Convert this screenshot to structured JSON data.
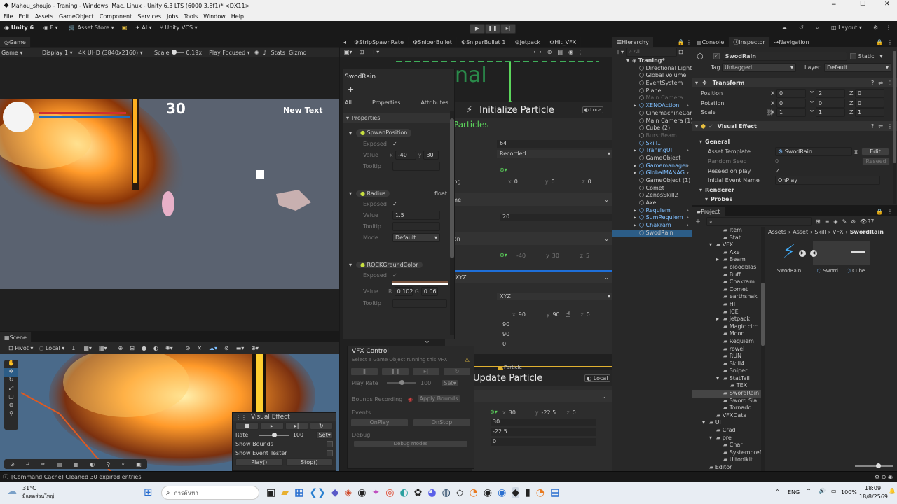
{
  "window": {
    "title": "Mahou_shoujo - Traning - Windows, Mac, Linux - Unity 6.3 LTS (6000.3.8f1)* <DX11>",
    "min": "−",
    "max": "☐",
    "close": "✕"
  },
  "menubar": [
    "File",
    "Edit",
    "Assets",
    "GameObject",
    "Component",
    "Services",
    "Jobs",
    "Tools",
    "Window",
    "Help"
  ],
  "toolbar": {
    "unity": "Unity 6",
    "account": "F",
    "asset_store": "Asset Store",
    "ai": "AI",
    "vcs": "Unity VCS",
    "layout": "Layout"
  },
  "game": {
    "tab": "Game",
    "mode": "Game",
    "display": "Display 1",
    "resolution": "4K UHD (3840x2160)",
    "scale_label": "Scale",
    "scale_value": "0.19x",
    "play_focused": "Play Focused",
    "stats": "Stats",
    "gizmos": "Gizmo",
    "score": "30",
    "new_text": "New Text"
  },
  "scene": {
    "tab": "Scene",
    "pivot": "Pivot",
    "local": "Local",
    "snap": "1",
    "overlay_title": "Visual Effect",
    "rate_label": "Rate",
    "rate_value": "100",
    "rate_set": "Set",
    "show_bounds": "Show Bounds",
    "show_event_tester": "Show Event Tester",
    "play": "Play()",
    "stop": "Stop()"
  },
  "vfx_tabs": [
    "StripSpawnRate",
    "SniperBullet",
    "SniperBullet 1",
    "Jetpack",
    "Hit_VFX"
  ],
  "blackboard": {
    "title": "SwodRain",
    "add": "+",
    "tab_all": "All",
    "tab_properties": "Properties",
    "tab_attributes": "Attributes",
    "section": "Properties",
    "props": [
      {
        "name": "SpwanPosition",
        "type": "",
        "exposed_label": "Exposed",
        "value_label": "Value",
        "x_label": "x",
        "x": "-40",
        "y_label": "y",
        "y": "30",
        "tooltip_label": "Tooltip"
      },
      {
        "name": "Radius",
        "type": "float",
        "exposed_label": "Exposed",
        "value_label": "Value",
        "value": "1.5",
        "tooltip_label": "Tooltip",
        "mode_label": "Mode",
        "mode": "Default"
      },
      {
        "name": "ROCKGroundColor",
        "type": "",
        "exposed_label": "Exposed",
        "value_label": "Value",
        "r_label": "R",
        "r": "0.102",
        "g_label": "G",
        "g": "0.06",
        "tooltip_label": "Tooltip"
      }
    ]
  },
  "graph": {
    "title_fragment": "nal",
    "init_title": "Initialize Particle",
    "local": "Loca",
    "particles": "Particles",
    "capacity": "64",
    "bounds_mode": "Recorded",
    "padding_label": "dding",
    "pad_x": "0",
    "pad_y": "0",
    "pad_z": "0",
    "lifetime_label": "etime",
    "lifetime": "20",
    "position_label": "sition",
    "pos_x": "-40",
    "pos_y": "30",
    "pos_z": "5",
    "angle_label": "gle.XYZ",
    "angle_mode": "XYZ",
    "ang_x": "90",
    "ang_y": "90",
    "ang_z": "0",
    "v1": "90",
    "v2": "90",
    "v3": "0",
    "y_label": "Y",
    "update_context": "Particle",
    "update_title": "Update Particle",
    "update_local": "Local",
    "upd_x": "30",
    "upd_y": "-22.5",
    "upd_z": "0",
    "u1": "30",
    "u2": "-22.5",
    "u3": "0"
  },
  "vfx_control": {
    "title": "VFX Control",
    "subtitle": "Select a Game Object running this VFX",
    "play_rate_label": "Play Rate",
    "play_rate": "100",
    "set": "Set",
    "bounds_label": "Bounds Recording",
    "apply_bounds": "Apply Bounds",
    "events_label": "Events",
    "onplay": "OnPlay",
    "onstop": "OnStop",
    "debug_label": "Debug",
    "debug_modes": "Debug modes"
  },
  "hierarchy": {
    "tab": "Hierarchy",
    "search": "All",
    "items": [
      {
        "label": "Traning*",
        "depth": 0,
        "arrow": "▾",
        "kind": "scene"
      },
      {
        "label": "Directional Light",
        "depth": 1,
        "arrow": "",
        "kind": "go"
      },
      {
        "label": "Global Volume",
        "depth": 1,
        "arrow": "",
        "kind": "go"
      },
      {
        "label": "EventSystem",
        "depth": 1,
        "arrow": "",
        "kind": "go"
      },
      {
        "label": "Plane",
        "depth": 1,
        "arrow": "",
        "kind": "go"
      },
      {
        "label": "Main Camera",
        "depth": 1,
        "arrow": "",
        "kind": "dim"
      },
      {
        "label": "XENOAction",
        "depth": 1,
        "arrow": "▸",
        "kind": "prefab"
      },
      {
        "label": "CinemachineCam",
        "depth": 1,
        "arrow": "",
        "kind": "go"
      },
      {
        "label": "Main Camera (1)",
        "depth": 1,
        "arrow": "",
        "kind": "go"
      },
      {
        "label": "Cube (2)",
        "depth": 1,
        "arrow": "",
        "kind": "go"
      },
      {
        "label": "BurstBeam",
        "depth": 1,
        "arrow": "",
        "kind": "dim"
      },
      {
        "label": "Skill1",
        "depth": 1,
        "arrow": "",
        "kind": "prefab"
      },
      {
        "label": "TraningUI",
        "depth": 1,
        "arrow": "▸",
        "kind": "prefab"
      },
      {
        "label": "GameObject",
        "depth": 1,
        "arrow": "",
        "kind": "go"
      },
      {
        "label": "Gamemanager",
        "depth": 1,
        "arrow": "▸",
        "kind": "prefab"
      },
      {
        "label": "GlobalMANAG",
        "depth": 1,
        "arrow": "▸",
        "kind": "prefab"
      },
      {
        "label": "GameObject (1)",
        "depth": 1,
        "arrow": "",
        "kind": "go"
      },
      {
        "label": "Comet",
        "depth": 1,
        "arrow": "",
        "kind": "go"
      },
      {
        "label": "ZenosSkill2",
        "depth": 1,
        "arrow": "",
        "kind": "go"
      },
      {
        "label": "Axe",
        "depth": 1,
        "arrow": "",
        "kind": "go"
      },
      {
        "label": "Requiem",
        "depth": 1,
        "arrow": "▸",
        "kind": "prefab"
      },
      {
        "label": "SumRequiem",
        "depth": 1,
        "arrow": "▸",
        "kind": "prefab"
      },
      {
        "label": "Chakram",
        "depth": 1,
        "arrow": "▸",
        "kind": "prefab"
      },
      {
        "label": "SwodRain",
        "depth": 1,
        "arrow": "",
        "kind": "selected"
      }
    ]
  },
  "inspector": {
    "tab_console": "Console",
    "tab_inspector": "Inspector",
    "tab_navigation": "Navigation",
    "object_name": "SwodRain",
    "static": "Static",
    "tag_label": "Tag",
    "tag": "Untagged",
    "layer_label": "Layer",
    "layer": "Default",
    "transform": {
      "title": "Transform",
      "rows": [
        {
          "label": "Position",
          "x": "0",
          "y": "2",
          "z": "0"
        },
        {
          "label": "Rotation",
          "x": "0",
          "y": "0",
          "z": "0"
        },
        {
          "label": "Scale",
          "x": "1",
          "y": "1",
          "z": "1"
        }
      ]
    },
    "vfx": {
      "title": "Visual Effect",
      "general": "General",
      "asset_template_label": "Asset Template",
      "asset_template": "SwodRain",
      "edit": "Edit",
      "random_seed_label": "Random Seed",
      "random_seed": "0",
      "reseed": "Reseed",
      "reseed_on_play": "Reseed on play",
      "initial_event_label": "Initial Event Name",
      "initial_event": "OnPlay",
      "renderer": "Renderer",
      "probes": "Probes"
    }
  },
  "project": {
    "tab": "Project",
    "count": "37",
    "breadcrumb": [
      "Assets",
      "Asset",
      "Skill",
      "VFX",
      "SwordRain"
    ],
    "tree": [
      {
        "label": "Item",
        "depth": 3,
        "arrow": ""
      },
      {
        "label": "Stat",
        "depth": 3,
        "arrow": ""
      },
      {
        "label": "VFX",
        "depth": 2,
        "arrow": "▾"
      },
      {
        "label": "Axe",
        "depth": 3,
        "arrow": ""
      },
      {
        "label": "Beam",
        "depth": 3,
        "arrow": "▸"
      },
      {
        "label": "bloodblas",
        "depth": 3,
        "arrow": ""
      },
      {
        "label": "Buff",
        "depth": 3,
        "arrow": ""
      },
      {
        "label": "Chakram",
        "depth": 3,
        "arrow": ""
      },
      {
        "label": "Comet",
        "depth": 3,
        "arrow": ""
      },
      {
        "label": "earthshak",
        "depth": 3,
        "arrow": ""
      },
      {
        "label": "HIT",
        "depth": 3,
        "arrow": ""
      },
      {
        "label": "ICE",
        "depth": 3,
        "arrow": ""
      },
      {
        "label": "jetpack",
        "depth": 3,
        "arrow": "▸"
      },
      {
        "label": "Magic circ",
        "depth": 3,
        "arrow": ""
      },
      {
        "label": "Moon",
        "depth": 3,
        "arrow": ""
      },
      {
        "label": "Requiem",
        "depth": 3,
        "arrow": ""
      },
      {
        "label": "rowel",
        "depth": 3,
        "arrow": ""
      },
      {
        "label": "RUN",
        "depth": 3,
        "arrow": ""
      },
      {
        "label": "Skill4",
        "depth": 3,
        "arrow": ""
      },
      {
        "label": "Sniper",
        "depth": 3,
        "arrow": ""
      },
      {
        "label": "StatTail",
        "depth": 3,
        "arrow": "▾"
      },
      {
        "label": "TEX",
        "depth": 4,
        "arrow": ""
      },
      {
        "label": "SwordRain",
        "depth": 3,
        "arrow": "",
        "selected": true
      },
      {
        "label": "Sword Sla",
        "depth": 3,
        "arrow": ""
      },
      {
        "label": "Tornado",
        "depth": 3,
        "arrow": ""
      },
      {
        "label": "VFXData",
        "depth": 2,
        "arrow": ""
      },
      {
        "label": "UI",
        "depth": 1,
        "arrow": "▾"
      },
      {
        "label": "Crad",
        "depth": 2,
        "arrow": ""
      },
      {
        "label": "pre",
        "depth": 2,
        "arrow": "▾"
      },
      {
        "label": "Char",
        "depth": 3,
        "arrow": ""
      },
      {
        "label": "Systemprefa",
        "depth": 3,
        "arrow": ""
      },
      {
        "label": "UItoolkit",
        "depth": 3,
        "arrow": ""
      },
      {
        "label": "Editor",
        "depth": 1,
        "arrow": ""
      }
    ],
    "assets": [
      {
        "label": "SwodRain"
      },
      {
        "label": "Sword"
      },
      {
        "label": "Cube"
      }
    ]
  },
  "status": {
    "message": "[Command Cache] Cleaned 30 expired entries"
  },
  "taskbar": {
    "temp": "31°C",
    "weather": "มีแดดส่วนใหญ่",
    "search": "การค้นหา",
    "lang": "ENG",
    "battery": "100%",
    "time": "18:09",
    "date": "18/8/2569"
  },
  "colors": {
    "accent": "#2c5d87",
    "prefab": "#7fbfff",
    "green": "#5cd65c",
    "orange": "#ff7a1a"
  }
}
